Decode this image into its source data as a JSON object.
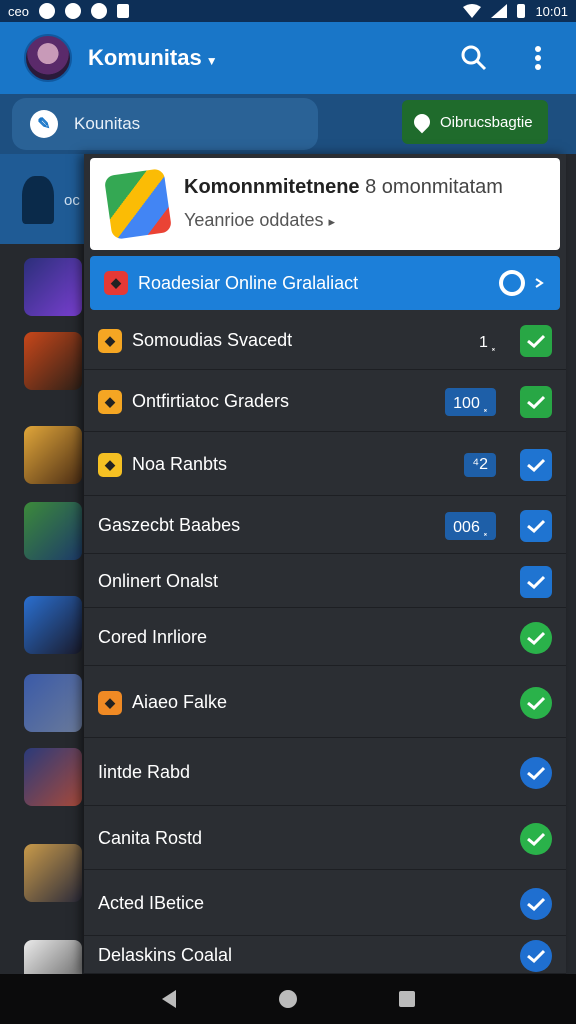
{
  "status_bar": {
    "left_text": "ceo",
    "time": "10:01"
  },
  "app_bar": {
    "title": "Komunitas",
    "icons": [
      "search-icon",
      "more-vert-icon"
    ]
  },
  "sub_bar": {
    "pill_label": "Kounitas",
    "button_label": "Oibrucsbagtie"
  },
  "hero_strip": {
    "text": "oc"
  },
  "header_card": {
    "title": "Komonnmitetnene",
    "title_suffix": "8 omonmitatam",
    "subtitle": "Yeanrioe oddates",
    "subtitle_caret": "▸"
  },
  "list": [
    {
      "label": "Roadesiar Online Gralaliact",
      "icon_color": "#e53935",
      "active": true,
      "count": "",
      "check": "globe"
    },
    {
      "label": "Somoudias Svacedt",
      "icon_color": "#f5a623",
      "count": "1 ⸼",
      "check": "green"
    },
    {
      "label": "Ontfirtiatoc Graders",
      "icon_color": "#f5a623",
      "count": "100 ⸼",
      "count_badge": true,
      "check": "green"
    },
    {
      "label": "Noa Ranbts",
      "icon_color": "#f5c023",
      "count": "⁴2",
      "count_badge": true,
      "check": "blue"
    },
    {
      "label": "Gaszecbt Baabes",
      "icon_color": "",
      "count": "006 ⸼",
      "count_badge": true,
      "check": "blue"
    },
    {
      "label": "Onlinert Onalst",
      "icon_color": "",
      "count": "",
      "check": "blue"
    },
    {
      "label": "Cored Inrliore",
      "icon_color": "",
      "count": "",
      "check": "gcirc"
    },
    {
      "label": "Aiaeo Falke",
      "icon_color": "#f08a24",
      "count": "",
      "check": "gcirc"
    },
    {
      "label": "Iintde Rabd",
      "icon_color": "",
      "count": "",
      "check": "bcirc"
    },
    {
      "label": "Canita Rostd",
      "icon_color": "",
      "count": "",
      "check": "gcirc"
    },
    {
      "label": "Acted IBetice",
      "icon_color": "",
      "count": "",
      "check": "bcirc"
    },
    {
      "label": "Delaskins Coalal",
      "icon_color": "",
      "count": "",
      "check": "bcirc"
    }
  ],
  "thumbnails": [
    {
      "colors": [
        "#2b2f7a",
        "#7a3fd1"
      ]
    },
    {
      "colors": [
        "#c8471a",
        "#2c2018"
      ]
    },
    {
      "colors": [
        "#e0a63a",
        "#4a2c14"
      ]
    },
    {
      "colors": [
        "#3c8a3a",
        "#1d3a6a"
      ]
    },
    {
      "colors": [
        "#2a6fd0",
        "#1a1a2a"
      ]
    },
    {
      "colors": [
        "#3a5aa8",
        "#6a7a9a"
      ]
    },
    {
      "colors": [
        "#2a3a7a",
        "#a84a3a"
      ]
    },
    {
      "colors": [
        "#c89a4a",
        "#2a2a3a"
      ]
    },
    {
      "colors": [
        "#eaeaea",
        "#555555"
      ]
    }
  ]
}
